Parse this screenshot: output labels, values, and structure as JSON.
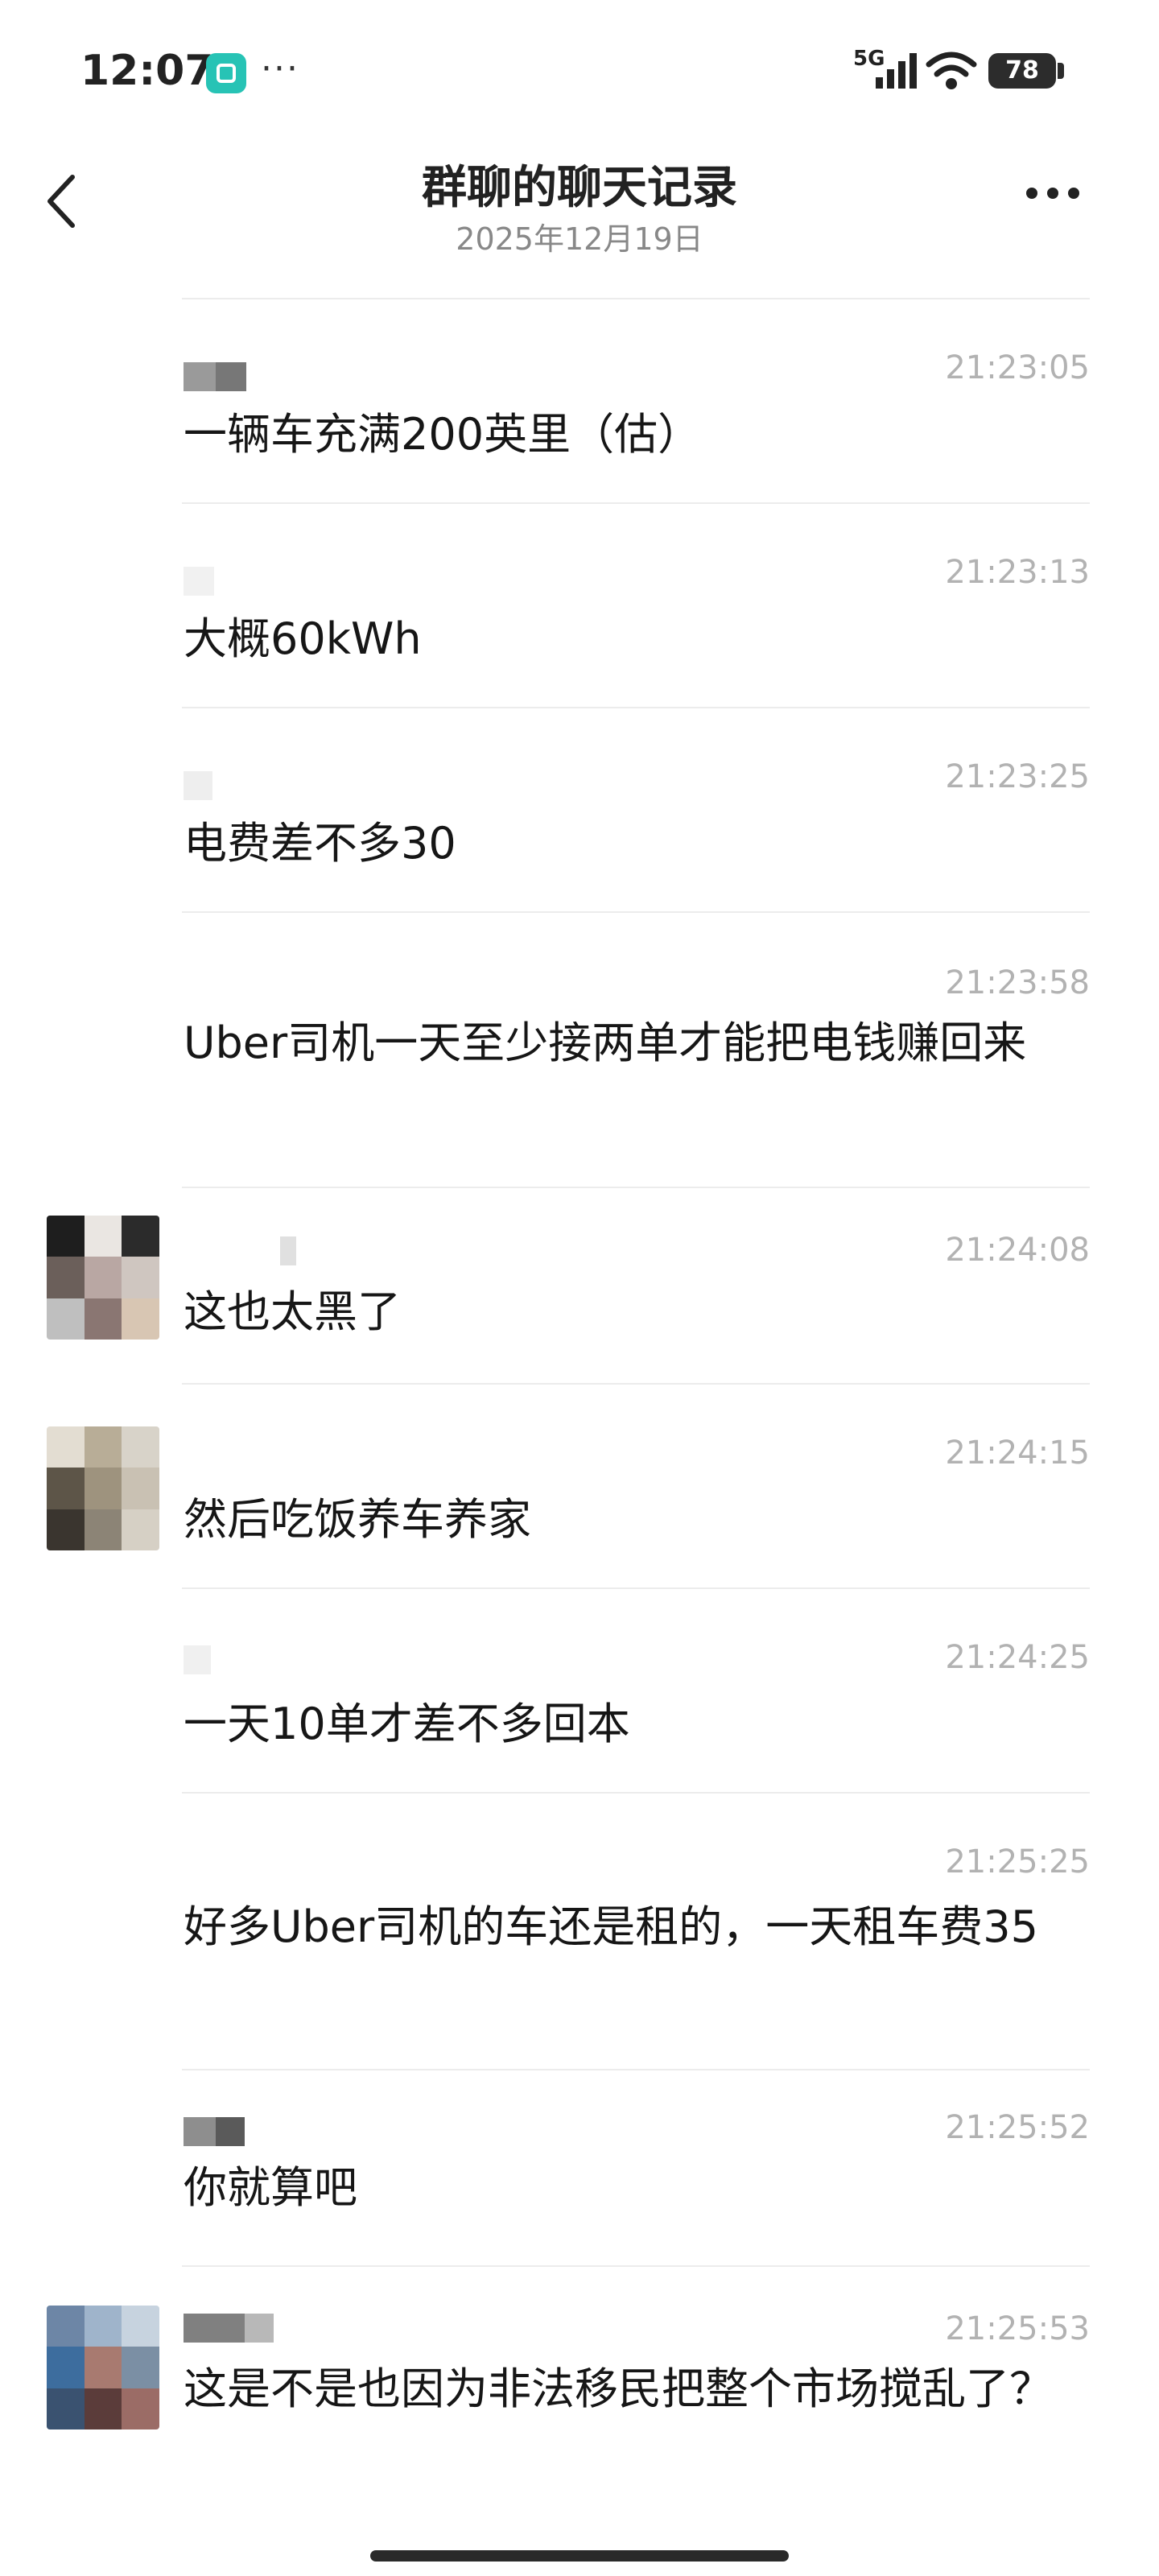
{
  "status_bar": {
    "time": "12:07",
    "network": "5G",
    "battery": "78"
  },
  "header": {
    "title": "群聊的聊天记录",
    "date": "2025年12月19日"
  },
  "messages": [
    {
      "time": "21:23:05",
      "text": "一辆车充满200英里（估）"
    },
    {
      "time": "21:23:13",
      "text": "大概60kWh"
    },
    {
      "time": "21:23:25",
      "text": "电费差不多30"
    },
    {
      "time": "21:23:58",
      "text": "Uber司机一天至少接两单才能把电钱赚回来"
    },
    {
      "time": "21:24:08",
      "text": "这也太黑了"
    },
    {
      "time": "21:24:15",
      "text": "然后吃饭养车养家"
    },
    {
      "time": "21:24:25",
      "text": "一天10单才差不多回本"
    },
    {
      "time": "21:25:25",
      "text": "好多Uber司机的车还是租的，一天租车费35"
    },
    {
      "time": "21:25:52",
      "text": "你就算吧"
    },
    {
      "time": "21:25:53",
      "text": "这是不是也因为非法移民把整个市场搅乱了？"
    }
  ],
  "colors": {
    "app_icon": "#27c3b5",
    "timestamp": "#b2b2b2",
    "subtitle": "#888888"
  },
  "icons": {
    "back": "chevron-left-icon",
    "more": "more-dots-icon"
  }
}
